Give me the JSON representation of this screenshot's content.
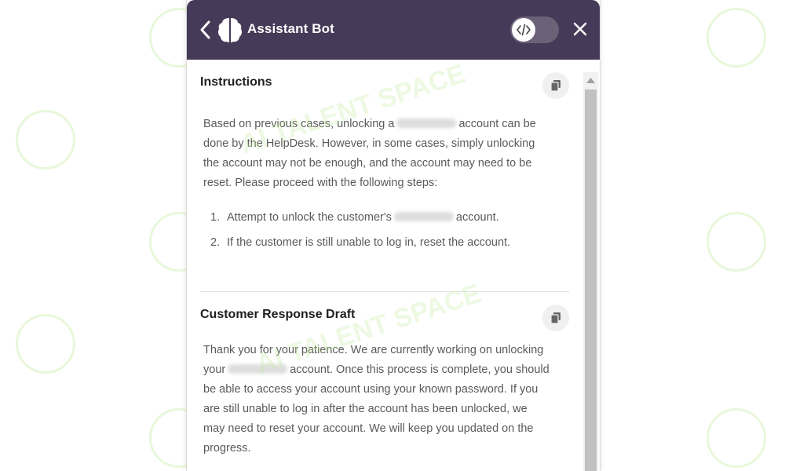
{
  "header": {
    "title": "Assistant Bot",
    "background": "#453a57",
    "toggle_icon": "code-icon"
  },
  "watermark": {
    "text": "AI TALENT SPACE",
    "color": "#bfe99a"
  },
  "instructions": {
    "title": "Instructions",
    "paragraph_lines": [
      [
        "Based on previous cases, unlocking a",
        "account can be"
      ],
      [
        "done by the HelpDesk. However, in some cases, simply unlocking"
      ],
      [
        "the account may not be enough, and the account may need to be"
      ],
      [
        "reset. Please proceed with the following steps:"
      ]
    ],
    "steps": [
      {
        "num": "1.",
        "before": "Attempt to unlock the customer's",
        "after": "account."
      },
      {
        "num": "2.",
        "text": "If the customer is still unable to log in, reset the account."
      }
    ]
  },
  "draft": {
    "title": "Customer Response Draft",
    "paragraph_lines": [
      [
        "Thank you for your patience. We are currently working on unlocking"
      ],
      [
        "your",
        "account. Once this process is complete, you should"
      ],
      [
        "be able to access your account using your known password. If you"
      ],
      [
        "are still unable to log in after the account has been unlocked, we"
      ],
      [
        "may need to reset your account. We will keep you updated on the"
      ],
      [
        "progress."
      ]
    ]
  }
}
